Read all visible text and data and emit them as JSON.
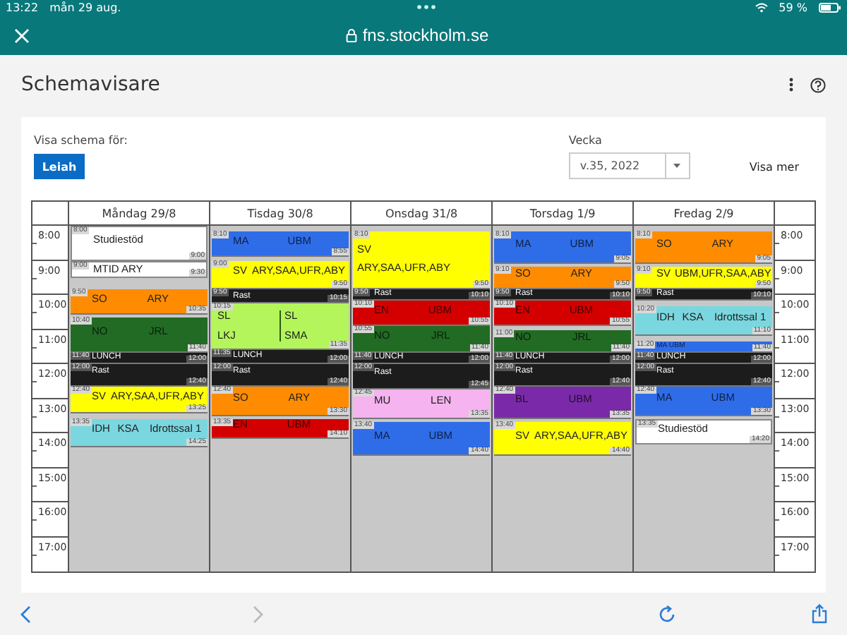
{
  "status_bar": {
    "time": "13:22",
    "date": "mån 29 aug.",
    "battery": "59 %"
  },
  "browser": {
    "url": "fns.stockholm.se"
  },
  "app": {
    "title": "Schemavisare"
  },
  "filter": {
    "label": "Visa schema för:",
    "person": "Leiah",
    "week_label": "Vecka",
    "week_value": "v.35, 2022",
    "more_link": "Visa mer"
  },
  "schedule": {
    "hours_left": [
      "8:00",
      "9:00",
      "10:00",
      "11:00",
      "12:00",
      "13:00",
      "14:00",
      "15:00",
      "16:00",
      "17:00"
    ],
    "hours_right": [
      "8:00",
      "9:00",
      "10:00",
      "11:00",
      "12:00",
      "13:00",
      "14:00",
      "15:00",
      "16:00",
      "17:00"
    ],
    "days": [
      {
        "name": "Måndag 29/8",
        "events": [
          {
            "kind": "row",
            "color": "#ffffff",
            "texts": [
              "Studiestöd"
            ],
            "start": "8:00",
            "end": "9:00"
          },
          {
            "kind": "row",
            "color": "#ffffff",
            "texts": [
              "MTID ARY"
            ],
            "start": "9:00",
            "end": "9:30"
          },
          {
            "kind": "row",
            "color": "#ff8c00",
            "texts": [
              "SO",
              "ARY"
            ],
            "start": "9:50",
            "end": "10:35"
          },
          {
            "kind": "row",
            "color": "#226b24",
            "texts": [
              "NO",
              "JRL"
            ],
            "start": "10:40",
            "end": "11:40"
          },
          {
            "kind": "break",
            "color": "#1c1c1c",
            "texts": [
              "LUNCH"
            ],
            "start": "11:40",
            "end": "12:00"
          },
          {
            "kind": "break",
            "color": "#1c1c1c",
            "texts": [
              "Rast"
            ],
            "start": "12:00",
            "end": "12:40"
          },
          {
            "kind": "row",
            "color": "#ffff00",
            "texts": [
              "SV",
              "ARY,SAA,UFR,ABY"
            ],
            "start": "12:40",
            "end": "13:25"
          },
          {
            "kind": "row",
            "color": "#7ad7e0",
            "texts": [
              "IDH",
              "KSA",
              "Idrottssal 1"
            ],
            "start": "13:35",
            "end": "14:25"
          }
        ]
      },
      {
        "name": "Tisdag 30/8",
        "events": [
          {
            "kind": "row",
            "color": "#2f6de8",
            "texts": [
              "MA",
              "UBM"
            ],
            "start": "8:10",
            "end": "8:55"
          },
          {
            "kind": "row",
            "color": "#ffff00",
            "texts": [
              "SV",
              "ARY,SAA,UFR,ABY"
            ],
            "start": "9:00",
            "end": "9:50"
          },
          {
            "kind": "break",
            "color": "#1c1c1c",
            "texts": [
              "Rast"
            ],
            "start": "9:50",
            "end": "10:15"
          },
          {
            "kind": "split",
            "color": "#b3f55a",
            "groups": [
              [
                "SL",
                "LKJ"
              ],
              [
                "SL",
                "SMA"
              ]
            ],
            "start": "10:15",
            "end": "11:35"
          },
          {
            "kind": "break",
            "color": "#1c1c1c",
            "texts": [
              "LUNCH"
            ],
            "start": "11:35",
            "end": "12:00"
          },
          {
            "kind": "break",
            "color": "#1c1c1c",
            "texts": [
              "Rast"
            ],
            "start": "12:00",
            "end": "12:40"
          },
          {
            "kind": "row",
            "color": "#ff8c00",
            "texts": [
              "SO",
              "ARY"
            ],
            "start": "12:40",
            "end": "13:30"
          },
          {
            "kind": "row",
            "color": "#d40000",
            "texts": [
              "EN",
              "UBM"
            ],
            "start": "13:35",
            "end": "14:10"
          }
        ]
      },
      {
        "name": "Onsdag 31/8",
        "events": [
          {
            "kind": "stack",
            "color": "#ffff00",
            "texts": [
              "SV",
              "ARY,SAA,UFR,ABY"
            ],
            "start": "8:10",
            "end": "9:50"
          },
          {
            "kind": "break",
            "color": "#1c1c1c",
            "texts": [
              "Rast"
            ],
            "start": "9:50",
            "end": "10:10"
          },
          {
            "kind": "row",
            "color": "#d40000",
            "texts": [
              "EN",
              "UBM"
            ],
            "start": "10:10",
            "end": "10:55"
          },
          {
            "kind": "row",
            "color": "#226b24",
            "texts": [
              "NO",
              "JRL"
            ],
            "start": "10:55",
            "end": "11:40"
          },
          {
            "kind": "break",
            "color": "#1c1c1c",
            "texts": [
              "LUNCH"
            ],
            "start": "11:40",
            "end": "12:00"
          },
          {
            "kind": "break",
            "color": "#1c1c1c",
            "texts": [
              "Rast"
            ],
            "start": "12:00",
            "end": "12:45"
          },
          {
            "kind": "row",
            "color": "#f5b3f0",
            "texts": [
              "MU",
              "LEN"
            ],
            "start": "12:45",
            "end": "13:35"
          },
          {
            "kind": "row",
            "color": "#2f6de8",
            "texts": [
              "MA",
              "UBM"
            ],
            "start": "13:40",
            "end": "14:40"
          }
        ]
      },
      {
        "name": "Torsdag 1/9",
        "events": [
          {
            "kind": "row",
            "color": "#2f6de8",
            "texts": [
              "MA",
              "UBM"
            ],
            "start": "8:10",
            "end": "9:05"
          },
          {
            "kind": "row",
            "color": "#ff8c00",
            "texts": [
              "SO",
              "ARY"
            ],
            "start": "9:10",
            "end": "9:50"
          },
          {
            "kind": "break",
            "color": "#1c1c1c",
            "texts": [
              "Rast"
            ],
            "start": "9:50",
            "end": "10:10"
          },
          {
            "kind": "row",
            "color": "#d40000",
            "texts": [
              "EN",
              "UBM"
            ],
            "start": "10:10",
            "end": "10:55"
          },
          {
            "kind": "row",
            "color": "#226b24",
            "texts": [
              "NO",
              "JRL"
            ],
            "start": "11:00",
            "end": "11:40"
          },
          {
            "kind": "break",
            "color": "#1c1c1c",
            "texts": [
              "LUNCH"
            ],
            "start": "11:40",
            "end": "12:00"
          },
          {
            "kind": "break",
            "color": "#1c1c1c",
            "texts": [
              "Rast"
            ],
            "start": "12:00",
            "end": "12:40"
          },
          {
            "kind": "row",
            "color": "#7a2aa8",
            "texts": [
              "BL",
              "UBM"
            ],
            "start": "12:40",
            "end": "13:35"
          },
          {
            "kind": "row",
            "color": "#ffff00",
            "texts": [
              "SV",
              "ARY,SAA,UFR,ABY"
            ],
            "start": "13:40",
            "end": "14:40"
          }
        ]
      },
      {
        "name": "Fredag 2/9",
        "events": [
          {
            "kind": "row",
            "color": "#ff8c00",
            "texts": [
              "SO",
              "ARY"
            ],
            "start": "8:10",
            "end": "9:05"
          },
          {
            "kind": "row",
            "color": "#ffff00",
            "texts": [
              "SV",
              "UBM,UFR,SAA,ABY"
            ],
            "start": "9:10",
            "end": "9:50"
          },
          {
            "kind": "break",
            "color": "#1c1c1c",
            "texts": [
              "Rast"
            ],
            "start": "9:50",
            "end": "10:10"
          },
          {
            "kind": "row",
            "color": "#7ad7e0",
            "texts": [
              "IDH",
              "KSA",
              "Idrottssal 1"
            ],
            "start": "10:20",
            "end": "11:10"
          },
          {
            "kind": "row",
            "color": "#2f6de8",
            "texts": [
              "MA UBM"
            ],
            "start": "11:20",
            "end": "11:40"
          },
          {
            "kind": "break",
            "color": "#1c1c1c",
            "texts": [
              "LUNCH"
            ],
            "start": "11:40",
            "end": "12:00"
          },
          {
            "kind": "break",
            "color": "#1c1c1c",
            "texts": [
              "Rast"
            ],
            "start": "12:00",
            "end": "12:40"
          },
          {
            "kind": "row",
            "color": "#2f6de8",
            "texts": [
              "MA",
              "UBM"
            ],
            "start": "12:40",
            "end": "13:30"
          },
          {
            "kind": "row",
            "color": "#ffffff",
            "texts": [
              "Studiestöd"
            ],
            "start": "13:35",
            "end": "14:20"
          }
        ]
      }
    ]
  }
}
